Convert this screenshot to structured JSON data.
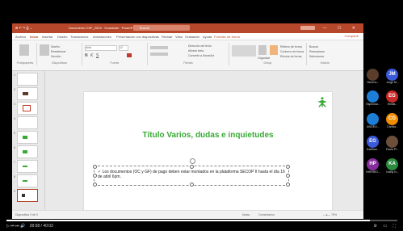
{
  "app": {
    "qat": "⊞ ↶ ↷ ⎙ ⌄",
    "title": "Documento CSF_2024 · Guardado · PowerPoint",
    "search": "Buscar",
    "user": "AM",
    "window_controls": "— ☐ ✕",
    "colors": {
      "brand": "#b7472a",
      "accent": "#39a935"
    }
  },
  "menu": {
    "items": [
      "Archivo",
      "Inicio",
      "Insertar",
      "Diseño",
      "Transiciones",
      "Animaciones",
      "Presentación con diapositivas",
      "Revisar",
      "Vista",
      "Grabación",
      "Ayuda",
      "Formato de forma"
    ],
    "share": "Compartir"
  },
  "ribbon": {
    "groups": [
      "Portapapeles",
      "Diapositivas",
      "Fuente",
      "Párrafo",
      "Dibujo",
      "Edición"
    ],
    "font_name": "Arial",
    "font_size": "12",
    "items": [
      "Nueva diapositiva",
      "Diseño",
      "Restablecer",
      "Sección",
      "Dirección del texto",
      "Alinear texto",
      "Convertir a SmartArt",
      "Organizar",
      "Estilos rápidos",
      "Relleno de forma",
      "Contorno de forma",
      "Efectos de forma",
      "Buscar",
      "Reemplazar",
      "Seleccionar"
    ]
  },
  "thumbnails": [
    "1",
    "2",
    "3",
    "4",
    "5",
    "6",
    "7",
    "8",
    "9"
  ],
  "slide": {
    "title": "Título Varios, dudas e inquietudes",
    "bullet": "Los documentos (OC y GF) de pago deben estar montados en la plataforma SECOP II hasta el día 16 de abril 6pm."
  },
  "status": {
    "left": "Diapositiva 9 de 9",
    "notes": "Notas",
    "comments": "Comentarios",
    "zoom": "—●— 79%"
  },
  "participants": [
    {
      "initials": "",
      "name": "Moreno...",
      "color": "#5a3e2b"
    },
    {
      "initials": "JM",
      "name": "Jorge M...",
      "color": "#3b5bdb"
    },
    {
      "initials": "",
      "name": "Espinosa...",
      "color": "#1c7ed6"
    },
    {
      "initials": "EG",
      "name": "Emilia...",
      "color": "#c92a2a"
    },
    {
      "initials": "",
      "name": "ANGELI...",
      "color": "#1c7ed6"
    },
    {
      "initials": "CG",
      "name": "Camila...",
      "color": "#f08c00"
    },
    {
      "initials": "EG",
      "name": "Esteban...",
      "color": "#3b5bdb"
    },
    {
      "initials": "",
      "name": "Paola Pi...",
      "color": "#6b4f3a"
    },
    {
      "initials": "HP",
      "name": "HHERED...",
      "color": "#862e9c"
    },
    {
      "initials": "KA",
      "name": "Kathy N...",
      "color": "#2b8a3e"
    }
  ],
  "player": {
    "progress": 0.93,
    "time": "28:58 / 40:03",
    "controls_left": "▷  ⏮  ⏭  🔊",
    "controls_right": "⚙ ▭ ⛶"
  }
}
